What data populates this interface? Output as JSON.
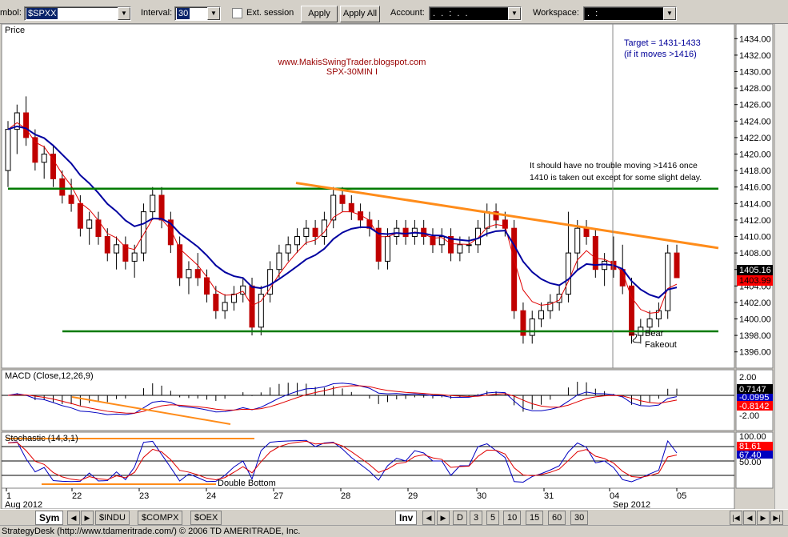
{
  "toolbar": {
    "symbol_label": "mbol:",
    "symbol_value": "$SPXX",
    "interval_label": "Interval:",
    "interval_value": "30",
    "ext_session_label": "Ext. session",
    "apply_label": "Apply",
    "apply_all_label": "Apply All",
    "account_label": "Account:",
    "account_value": ". . : . .",
    "workspace_label": "Workspace:",
    "workspace_value": ". :"
  },
  "price_pane": {
    "title": "Price",
    "header_line1": "www.MakisSwingTrader.blogspot.com",
    "header_line2": "SPX-30MIN I",
    "target_line1": "Target = 1431-1433",
    "target_line2": "(if it moves >1416)",
    "comment_line1": "It should have no trouble moving >1416 once",
    "comment_line2": "1410 is taken out except for some slight delay.",
    "bear_label": "Bear",
    "fakeout_label": "Fakeout",
    "last_price": "1405.16",
    "ma_value": "1403.99",
    "y_ticks": [
      "1434.00",
      "1432.00",
      "1430.00",
      "1428.00",
      "1426.00",
      "1424.00",
      "1422.00",
      "1420.00",
      "1418.00",
      "1416.00",
      "1414.00",
      "1412.00",
      "1410.00",
      "1408.00",
      "1406.00",
      "1404.00",
      "1402.00",
      "1400.00",
      "1398.00",
      "1396.00"
    ]
  },
  "macd_pane": {
    "title": "MACD (Close,12,26,9)",
    "y_top": "2.00",
    "y_bottom": "-2.00",
    "value1": "0.7147",
    "value2": "-0.0995",
    "value3": "-0.8142"
  },
  "stoch_pane": {
    "title": "Stochastic (14,3,1)",
    "double_bottom_label": "Double Bottom",
    "y_top": "100.00",
    "y_mid": "50.00",
    "value1": "81.61",
    "value2": "67.40"
  },
  "x_axis": {
    "labels": [
      "1",
      "22",
      "23",
      "24",
      "27",
      "28",
      "29",
      "30",
      "31",
      "04",
      "05"
    ],
    "month_left": "Aug 2012",
    "month_right": "Sep 2012"
  },
  "bottom_tabs": {
    "sym": "Sym",
    "items": [
      "$INDU",
      "$COMPX",
      "$OEX"
    ],
    "inv": "Inv",
    "intervals": [
      "D",
      "3",
      "5",
      "10",
      "15",
      "60",
      "30"
    ]
  },
  "status": "StrategyDesk (http://www.tdameritrade.com/) © 2006 TD AMERITRADE, Inc.",
  "colors": {
    "up_candle": "#ffffff",
    "down_candle": "#c00000",
    "support_line": "#007a00",
    "trend_line": "#ff8c1a",
    "ma_blue": "#0000a0",
    "ma_red": "#e00000",
    "label_blue": "#000099",
    "label_red": "#990000"
  },
  "chart_data": {
    "type": "candlestick",
    "y_range": [
      1395,
      1435
    ],
    "support_level": 1398.5,
    "resistance_level": 1415.8,
    "trendline": {
      "start_price": 1416.5,
      "end_price": 1408.6
    },
    "candles": [
      [
        1418,
        1424,
        1416,
        1423
      ],
      [
        1423,
        1426,
        1420,
        1425
      ],
      [
        1425,
        1427,
        1421,
        1422
      ],
      [
        1422,
        1423,
        1418,
        1419
      ],
      [
        1419,
        1421,
        1417,
        1420
      ],
      [
        1420,
        1421,
        1416,
        1417
      ],
      [
        1417,
        1418,
        1414,
        1415
      ],
      [
        1415,
        1417,
        1413,
        1414
      ],
      [
        1414,
        1415,
        1410,
        1411
      ],
      [
        1411,
        1413,
        1409,
        1412
      ],
      [
        1412,
        1413,
        1409,
        1410
      ],
      [
        1410,
        1411,
        1407,
        1408
      ],
      [
        1408,
        1410,
        1406,
        1409
      ],
      [
        1409,
        1410,
        1406,
        1407
      ],
      [
        1407,
        1409,
        1405,
        1408
      ],
      [
        1408,
        1414,
        1407,
        1413
      ],
      [
        1413,
        1416,
        1412,
        1415
      ],
      [
        1415,
        1416,
        1411,
        1412
      ],
      [
        1412,
        1413,
        1408,
        1409
      ],
      [
        1409,
        1410,
        1404,
        1405
      ],
      [
        1405,
        1407,
        1403,
        1406
      ],
      [
        1406,
        1408,
        1404,
        1405
      ],
      [
        1405,
        1406,
        1402,
        1403
      ],
      [
        1403,
        1404,
        1400,
        1401
      ],
      [
        1401,
        1403,
        1400,
        1402
      ],
      [
        1402,
        1404,
        1401,
        1403
      ],
      [
        1403,
        1405,
        1402,
        1404
      ],
      [
        1404,
        1405,
        1398,
        1399
      ],
      [
        1399,
        1404,
        1398,
        1403
      ],
      [
        1403,
        1407,
        1402,
        1406
      ],
      [
        1406,
        1409,
        1405,
        1408
      ],
      [
        1408,
        1410,
        1407,
        1409
      ],
      [
        1409,
        1411,
        1408,
        1410
      ],
      [
        1410,
        1412,
        1409,
        1411
      ],
      [
        1411,
        1412,
        1409,
        1410
      ],
      [
        1410,
        1413,
        1409,
        1412
      ],
      [
        1412,
        1416,
        1411,
        1415
      ],
      [
        1415,
        1416,
        1413,
        1414
      ],
      [
        1414,
        1415,
        1412,
        1413
      ],
      [
        1413,
        1414,
        1411,
        1412
      ],
      [
        1412,
        1413,
        1410,
        1411
      ],
      [
        1411,
        1412,
        1406,
        1407
      ],
      [
        1407,
        1411,
        1406,
        1410
      ],
      [
        1410,
        1412,
        1409,
        1411
      ],
      [
        1411,
        1412,
        1409,
        1410
      ],
      [
        1410,
        1412,
        1409,
        1411
      ],
      [
        1411,
        1412,
        1409,
        1410
      ],
      [
        1410,
        1411,
        1408,
        1409
      ],
      [
        1409,
        1411,
        1408,
        1410
      ],
      [
        1410,
        1411,
        1407,
        1408
      ],
      [
        1408,
        1410,
        1407,
        1409
      ],
      [
        1409,
        1410,
        1408,
        1409
      ],
      [
        1409,
        1412,
        1408,
        1411
      ],
      [
        1411,
        1414,
        1410,
        1413
      ],
      [
        1413,
        1414,
        1411,
        1412
      ],
      [
        1412,
        1413,
        1410,
        1411
      ],
      [
        1411,
        1412,
        1400,
        1401
      ],
      [
        1401,
        1402,
        1397,
        1398
      ],
      [
        1398,
        1401,
        1397,
        1400
      ],
      [
        1400,
        1402,
        1399,
        1401
      ],
      [
        1401,
        1403,
        1400,
        1402
      ],
      [
        1402,
        1404,
        1401,
        1403
      ],
      [
        1403,
        1413,
        1402,
        1408
      ],
      [
        1408,
        1412,
        1406,
        1411
      ],
      [
        1411,
        1412,
        1409,
        1410
      ],
      [
        1410,
        1411,
        1405,
        1406
      ],
      [
        1406,
        1408,
        1404,
        1407
      ],
      [
        1407,
        1410,
        1405,
        1406
      ],
      [
        1406,
        1409,
        1403,
        1404
      ],
      [
        1404,
        1405,
        1397,
        1398
      ],
      [
        1398,
        1400,
        1397,
        1399
      ],
      [
        1399,
        1401,
        1398,
        1400
      ],
      [
        1400,
        1402,
        1399,
        1401
      ],
      [
        1401,
        1409,
        1400,
        1408
      ],
      [
        1408,
        1409,
        1405,
        1405
      ]
    ]
  }
}
